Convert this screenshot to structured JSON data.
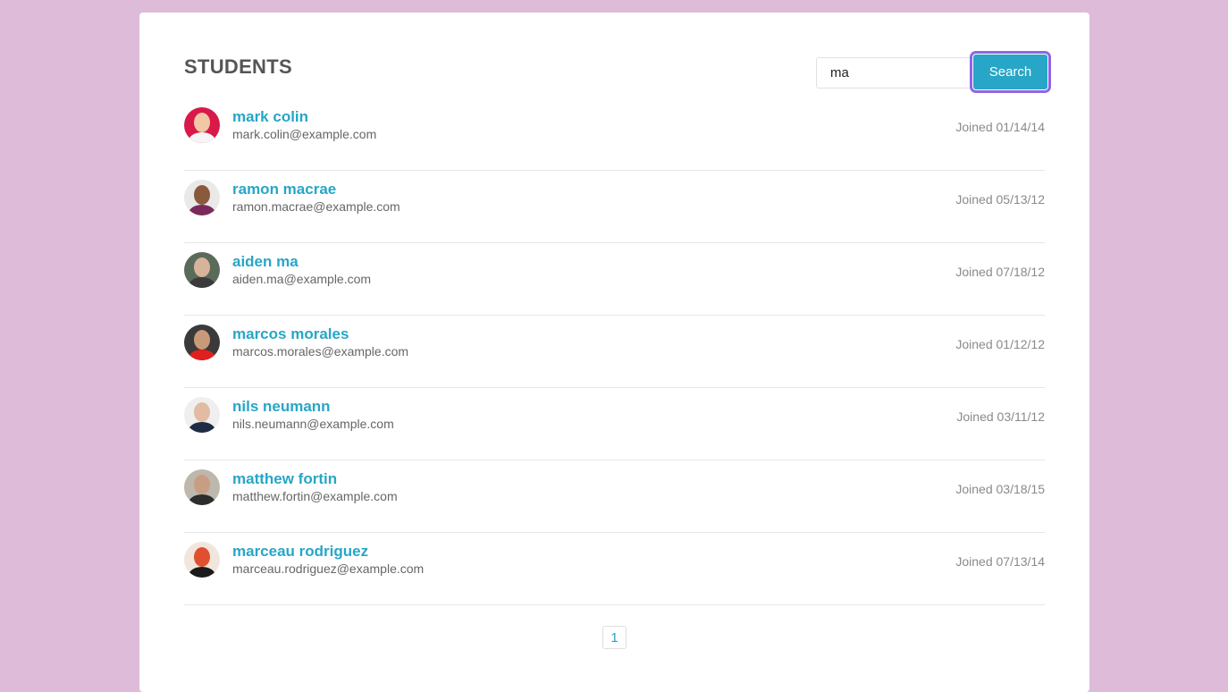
{
  "header": {
    "title": "STUDENTS",
    "search_value": "ma",
    "search_button": "Search"
  },
  "students": [
    {
      "name": "mark colin",
      "email": "mark.colin@example.com",
      "joined": "Joined 01/14/14",
      "avatar": "avatar-icon"
    },
    {
      "name": "ramon macrae",
      "email": "ramon.macrae@example.com",
      "joined": "Joined 05/13/12",
      "avatar": "avatar-icon"
    },
    {
      "name": "aiden ma",
      "email": "aiden.ma@example.com",
      "joined": "Joined 07/18/12",
      "avatar": "avatar-icon"
    },
    {
      "name": "marcos morales",
      "email": "marcos.morales@example.com",
      "joined": "Joined 01/12/12",
      "avatar": "avatar-icon"
    },
    {
      "name": "nils neumann",
      "email": "nils.neumann@example.com",
      "joined": "Joined 03/11/12",
      "avatar": "avatar-icon"
    },
    {
      "name": "matthew fortin",
      "email": "matthew.fortin@example.com",
      "joined": "Joined 03/18/15",
      "avatar": "avatar-icon"
    },
    {
      "name": "marceau rodriguez",
      "email": "marceau.rodriguez@example.com",
      "joined": "Joined 07/13/14",
      "avatar": "avatar-icon"
    }
  ],
  "pagination": {
    "current_page": "1"
  },
  "colors": {
    "background": "#ddbbd9",
    "accent": "#27a6c7",
    "focus_ring": "#8d66e6"
  }
}
